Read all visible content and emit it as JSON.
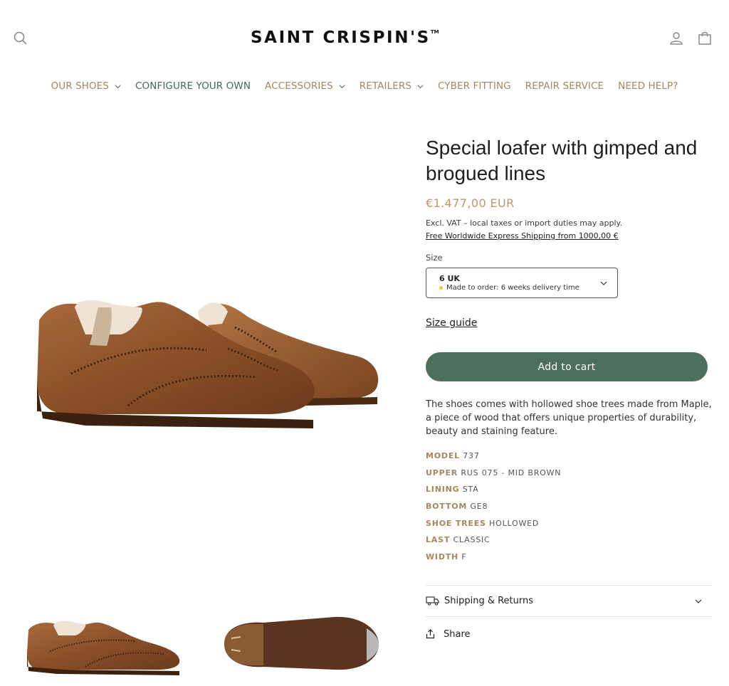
{
  "header": {
    "logo_text": "SAINT CRISPIN'S",
    "logo_tm": "TM"
  },
  "nav": {
    "items": [
      {
        "label": "OUR SHOES"
      },
      {
        "label": "CONFIGURE YOUR OWN"
      },
      {
        "label": "ACCESSORIES"
      },
      {
        "label": "RETAILERS"
      },
      {
        "label": "CYBER FITTING"
      },
      {
        "label": "REPAIR SERVICE"
      },
      {
        "label": "NEED HELP?"
      }
    ]
  },
  "product": {
    "title": "Special loafer with gimped and brogued lines",
    "price": "€1.477,00 EUR",
    "tax_note": "Excl. VAT – local taxes or import duties may apply.",
    "shipping_link": "Free Worldwide Express Shipping from 1000,00 €",
    "size_label": "Size",
    "size_value": "6 UK",
    "size_note": "Made to order: 6 weeks delivery time",
    "size_guide": "Size guide",
    "add_to_cart": "Add to cart",
    "description": "The shoes comes with hollowed shoe trees made from Maple, a piece of wood that offers unique properties of durability, beauty and staining feature.",
    "specs": [
      {
        "key": "MODEL",
        "value": "737"
      },
      {
        "key": "UPPER",
        "value": "RUS 075 - MID BROWN"
      },
      {
        "key": "LINING",
        "value": "STA"
      },
      {
        "key": "BOTTOM",
        "value": "GE8"
      },
      {
        "key": "SHOE TREES",
        "value": "HOLLOWED"
      },
      {
        "key": "LAST",
        "value": "CLASSIC"
      },
      {
        "key": "WIDTH",
        "value": "F"
      }
    ]
  },
  "accordion": {
    "shipping_label": "Shipping & Returns"
  },
  "share": {
    "label": "Share"
  },
  "colors": {
    "accent_gold": "#a3885f",
    "price_gold": "#b59a6f",
    "brand_green": "#4b6e5d",
    "nav_green": "#3f6a57",
    "status_dot": "#f2c22b"
  },
  "icons": [
    "search-icon",
    "account-icon",
    "cart-icon",
    "chevron-down-icon",
    "truck-icon",
    "share-icon"
  ]
}
